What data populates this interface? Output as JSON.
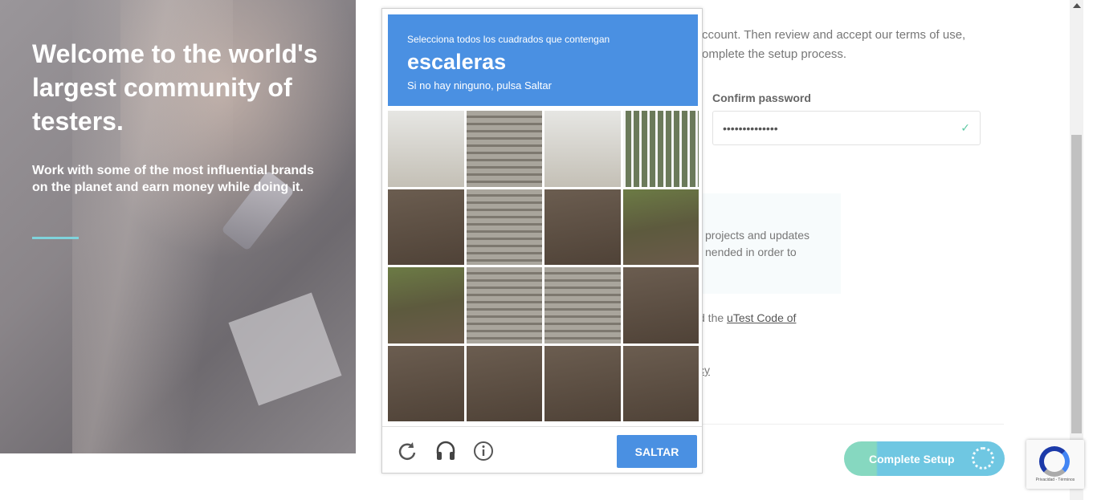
{
  "hero": {
    "title": "Welcome to the world's largest community of testers.",
    "subtitle": "Work with some of the most influential brands on the planet and earn money while doing it."
  },
  "form": {
    "intro_line1": "ccount. Then review and accept our terms of use,",
    "intro_line2": "omplete the setup process.",
    "confirm_password_label": "Confirm password",
    "confirm_password_value": "••••••••••••••",
    "notice_text": "projects and updates nended in order to",
    "code_prefix": "d the ",
    "code_link": "uTest Code of",
    "policy_fragment": "cy",
    "complete_button": "Complete Setup"
  },
  "captcha": {
    "instruction": "Selecciona todos los cuadrados que contengan",
    "target": "escaleras",
    "skip_hint": "Si no hay ninguno, pulsa Saltar",
    "skip_button": "SALTAR",
    "icons": [
      "reload-icon",
      "headphones-icon",
      "info-icon"
    ]
  },
  "badge": {
    "links": "Privacidad - Términos"
  },
  "colors": {
    "captcha_blue": "#4a90e2",
    "button_green": "#86d8c0",
    "button_teal": "#6fc7e2",
    "accent_rule": "#7fd3dc"
  }
}
